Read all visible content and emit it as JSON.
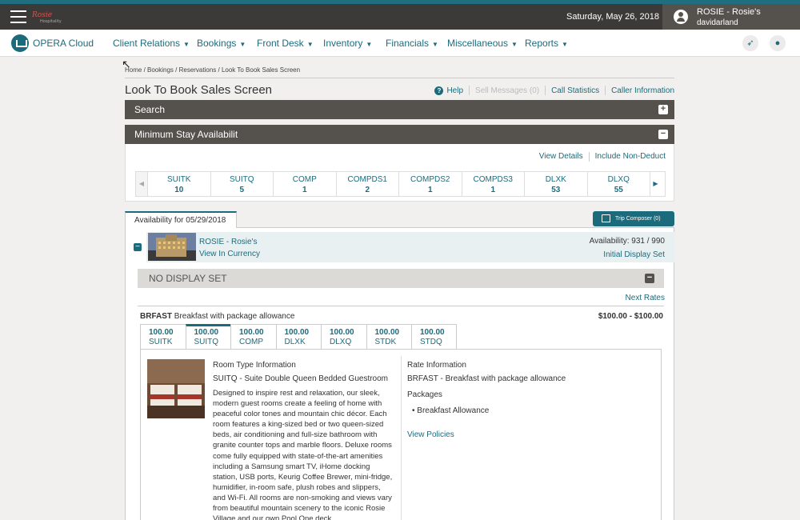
{
  "topbar": {
    "date": "Saturday, May 26, 2018",
    "user_name": "ROSIE - Rosie's",
    "user_id": "davidarland"
  },
  "nav": {
    "brand": "OPERA Cloud",
    "items": [
      {
        "label": "Client Relations"
      },
      {
        "label": "Bookings"
      },
      {
        "label": "Front Desk"
      },
      {
        "label": "Inventory"
      },
      {
        "label": "Financials"
      },
      {
        "label": "Miscellaneous"
      },
      {
        "label": "Reports"
      }
    ]
  },
  "breadcrumb": "Home / Bookings / Reservations / Look To Book Sales Screen",
  "page_title": "Look To Book Sales Screen",
  "top_links": {
    "help": "Help",
    "sell_messages": "Sell Messages (0)",
    "call_statistics": "Call Statistics",
    "caller_information": "Caller Information"
  },
  "search_panel": {
    "title": "Search"
  },
  "min_stay": {
    "title": "Minimum Stay Availabilit",
    "view_details": "View Details",
    "include_non_deduct": "Include Non-Deduct",
    "rooms": [
      {
        "code": "SUITK",
        "count": "10"
      },
      {
        "code": "SUITQ",
        "count": "5"
      },
      {
        "code": "COMP",
        "count": "1"
      },
      {
        "code": "COMPDS1",
        "count": "2"
      },
      {
        "code": "COMPDS2",
        "count": "1"
      },
      {
        "code": "COMPDS3",
        "count": "1"
      },
      {
        "code": "DLXK",
        "count": "53"
      },
      {
        "code": "DLXQ",
        "count": "55"
      }
    ]
  },
  "availability": {
    "tab_label": "Availability for 05/29/2018",
    "trip_composer": "Trip Composer (0)",
    "hotel_name": "ROSIE - Rosie's",
    "view_in_currency": "View In Currency",
    "availability_count": "Availability: 931 / 990",
    "initial_display_set": "Initial Display Set",
    "no_display_set": "NO DISPLAY SET",
    "next_rates": "Next Rates",
    "rate_code": "BRFAST",
    "rate_desc": "Breakfast with package allowance",
    "rate_range": "$100.00 - $100.00",
    "rate_tabs": [
      {
        "amount": "100.00",
        "code": "SUITK"
      },
      {
        "amount": "100.00",
        "code": "SUITQ"
      },
      {
        "amount": "100.00",
        "code": "COMP"
      },
      {
        "amount": "100.00",
        "code": "DLXK"
      },
      {
        "amount": "100.00",
        "code": "DLXQ"
      },
      {
        "amount": "100.00",
        "code": "STDK"
      },
      {
        "amount": "100.00",
        "code": "STDQ"
      }
    ],
    "room_type_title": "Room Type Information",
    "room_type_sub": "SUITQ - Suite Double Queen Bedded Guestroom",
    "room_type_desc": "Designed to inspire rest and relaxation, our sleek, modern guest rooms create a feeling of home with peaceful color tones and mountain chic décor. Each room features a king-sized bed or two queen-sized beds, air conditioning and full-size bathroom with granite counter tops and marble floors. Deluxe rooms come fully equipped with state-of-the-art amenities including a Samsung smart TV, iHome docking station, USB ports, Keurig Coffee Brewer, mini-fridge, humidifier, in-room safe, plush robes and slippers, and Wi-Fi. All rooms are non-smoking and views vary from beautiful mountain scenery to the iconic Rosie Village and our own Pool One deck.",
    "rate_info_title": "Rate Information",
    "rate_info_sub": "BRFAST - Breakfast with package allowance",
    "packages_label": "Packages",
    "package_item": "Breakfast Allowance",
    "view_policies": "View Policies"
  },
  "colors": {
    "accent": "#1c6b7c",
    "dark_bar": "#55524e",
    "topbar": "#3c3a38"
  }
}
